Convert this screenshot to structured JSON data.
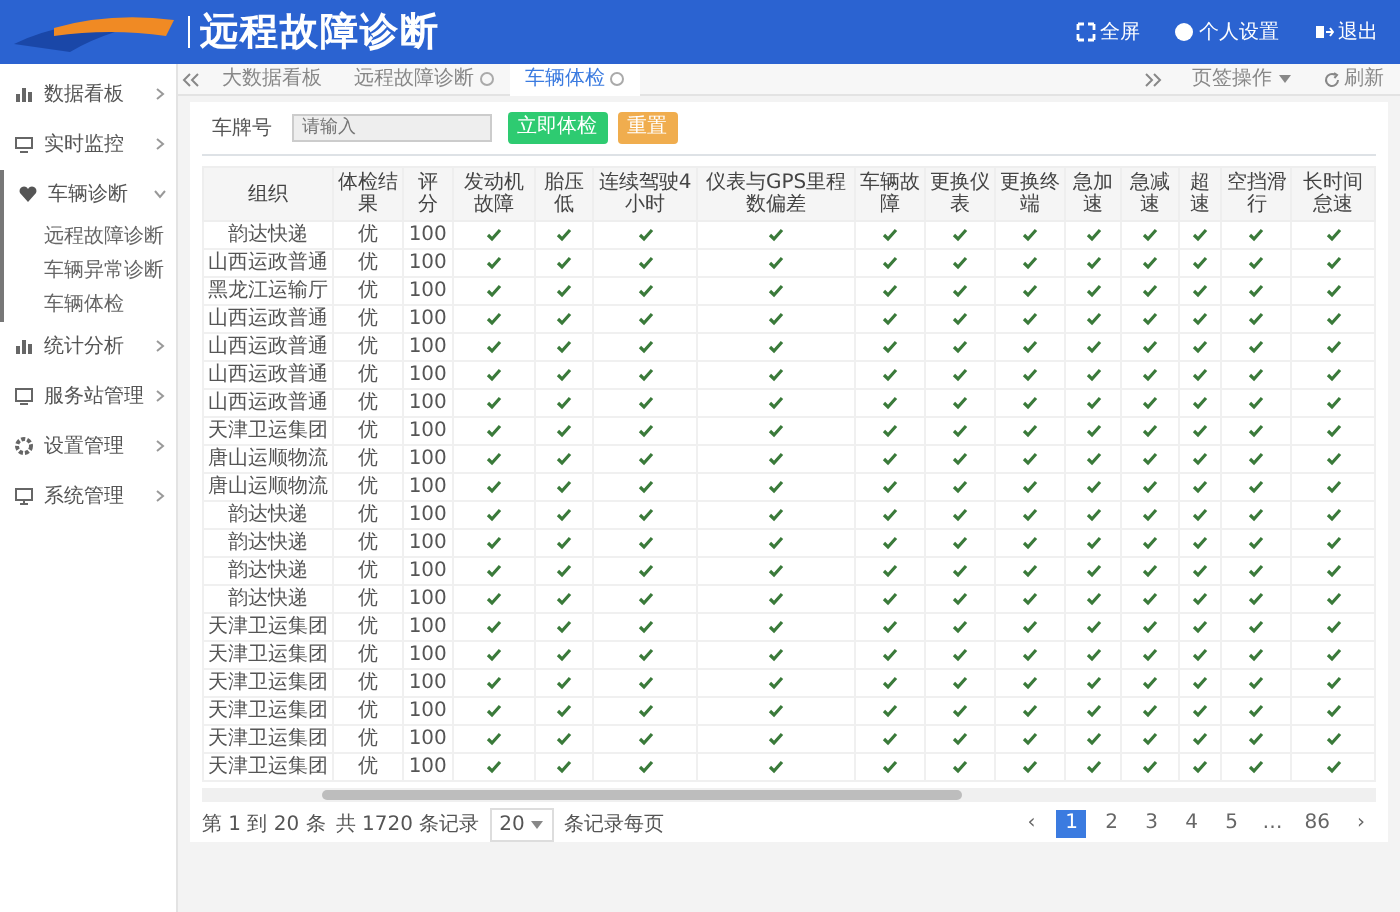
{
  "header": {
    "title": "远程故障诊断",
    "actions": [
      {
        "label": "全屏"
      },
      {
        "label": "个人设置"
      },
      {
        "label": "退出"
      }
    ]
  },
  "sidebar": {
    "items": [
      {
        "label": "数据看板",
        "expanded": false
      },
      {
        "label": "实时监控",
        "expanded": false
      },
      {
        "label": "车辆诊断",
        "expanded": true,
        "children": [
          {
            "label": "远程故障诊断"
          },
          {
            "label": "车辆异常诊断"
          },
          {
            "label": "车辆体检"
          }
        ]
      },
      {
        "label": "统计分析",
        "expanded": false
      },
      {
        "label": "服务站管理",
        "expanded": false
      },
      {
        "label": "设置管理",
        "expanded": false
      },
      {
        "label": "系统管理",
        "expanded": false
      }
    ]
  },
  "tabs": {
    "items": [
      {
        "label": "大数据看板",
        "closable": false,
        "selected": false
      },
      {
        "label": "远程故障诊断",
        "closable": true,
        "selected": false
      },
      {
        "label": "车辆体检",
        "closable": true,
        "selected": true
      }
    ],
    "menu": "页签操作",
    "refresh": "刷新"
  },
  "filter": {
    "label": "车牌号",
    "placeholder": "请输入",
    "buttons": [
      {
        "label": "立即体检",
        "kind": "success"
      },
      {
        "label": "重置",
        "kind": "warning"
      }
    ]
  },
  "table": {
    "columns": [
      "组织",
      "体检结果",
      "评分",
      "发动机故障",
      "胎压低",
      "连续驾驶4小时",
      "仪表与GPS里程数偏差",
      "车辆故障",
      "更换仪表",
      "更换终端",
      "急加速",
      "急减速",
      "超速",
      "空挡滑行",
      "长时间怠速"
    ],
    "rows": [
      {
        "cells": [
          "韵达快递",
          "优",
          "100"
        ],
        "checks": [
          true,
          true,
          true,
          true,
          true,
          true,
          true,
          true,
          true,
          true,
          true,
          true
        ]
      },
      {
        "cells": [
          "山西运政普通",
          "优",
          "100"
        ],
        "checks": [
          true,
          true,
          true,
          true,
          true,
          true,
          true,
          true,
          true,
          true,
          true,
          true
        ]
      },
      {
        "cells": [
          "黑龙江运输厅",
          "优",
          "100"
        ],
        "checks": [
          true,
          true,
          true,
          true,
          true,
          true,
          true,
          true,
          true,
          true,
          true,
          true
        ]
      },
      {
        "cells": [
          "山西运政普通",
          "优",
          "100"
        ],
        "checks": [
          true,
          true,
          true,
          true,
          true,
          true,
          true,
          true,
          true,
          true,
          true,
          true
        ]
      },
      {
        "cells": [
          "山西运政普通",
          "优",
          "100"
        ],
        "checks": [
          true,
          true,
          true,
          true,
          true,
          true,
          true,
          true,
          true,
          true,
          true,
          true
        ]
      },
      {
        "cells": [
          "山西运政普通",
          "优",
          "100"
        ],
        "checks": [
          true,
          true,
          true,
          true,
          true,
          true,
          true,
          true,
          true,
          true,
          true,
          true
        ]
      },
      {
        "cells": [
          "山西运政普通",
          "优",
          "100"
        ],
        "checks": [
          true,
          true,
          true,
          true,
          true,
          true,
          true,
          true,
          true,
          true,
          true,
          true
        ]
      },
      {
        "cells": [
          "天津卫运集团",
          "优",
          "100"
        ],
        "checks": [
          true,
          true,
          true,
          true,
          true,
          true,
          true,
          true,
          true,
          true,
          true,
          true
        ]
      },
      {
        "cells": [
          "唐山运顺物流",
          "优",
          "100"
        ],
        "checks": [
          true,
          true,
          true,
          true,
          true,
          true,
          true,
          true,
          true,
          true,
          true,
          true
        ]
      },
      {
        "cells": [
          "唐山运顺物流",
          "优",
          "100"
        ],
        "checks": [
          true,
          true,
          true,
          true,
          true,
          true,
          true,
          true,
          true,
          true,
          true,
          true
        ]
      },
      {
        "cells": [
          "韵达快递",
          "优",
          "100"
        ],
        "checks": [
          true,
          true,
          true,
          true,
          true,
          true,
          true,
          true,
          true,
          true,
          true,
          true
        ]
      },
      {
        "cells": [
          "韵达快递",
          "优",
          "100"
        ],
        "checks": [
          true,
          true,
          true,
          true,
          true,
          true,
          true,
          true,
          true,
          true,
          true,
          true
        ]
      },
      {
        "cells": [
          "韵达快递",
          "优",
          "100"
        ],
        "checks": [
          true,
          true,
          true,
          true,
          true,
          true,
          true,
          true,
          true,
          true,
          true,
          true
        ]
      },
      {
        "cells": [
          "韵达快递",
          "优",
          "100"
        ],
        "checks": [
          true,
          true,
          true,
          true,
          true,
          true,
          true,
          true,
          true,
          true,
          true,
          true
        ]
      },
      {
        "cells": [
          "天津卫运集团",
          "优",
          "100"
        ],
        "checks": [
          true,
          true,
          true,
          true,
          true,
          true,
          true,
          true,
          true,
          true,
          true,
          true
        ]
      },
      {
        "cells": [
          "天津卫运集团",
          "优",
          "100"
        ],
        "checks": [
          true,
          true,
          true,
          true,
          true,
          true,
          true,
          true,
          true,
          true,
          true,
          true
        ]
      },
      {
        "cells": [
          "天津卫运集团",
          "优",
          "100"
        ],
        "checks": [
          true,
          true,
          true,
          true,
          true,
          true,
          true,
          true,
          true,
          true,
          true,
          true
        ]
      },
      {
        "cells": [
          "天津卫运集团",
          "优",
          "100"
        ],
        "checks": [
          true,
          true,
          true,
          true,
          true,
          true,
          true,
          true,
          true,
          true,
          true,
          true
        ]
      },
      {
        "cells": [
          "天津卫运集团",
          "优",
          "100"
        ],
        "checks": [
          true,
          true,
          true,
          true,
          true,
          true,
          true,
          true,
          true,
          true,
          true,
          true
        ]
      },
      {
        "cells": [
          "天津卫运集团",
          "优",
          "100"
        ],
        "checks": [
          true,
          true,
          true,
          true,
          true,
          true,
          true,
          true,
          true,
          true,
          true,
          true
        ]
      }
    ]
  },
  "pagination": {
    "summary": "第 1 到 20 条",
    "total": "共 1720 条记录",
    "page_size": "20",
    "page_size_suffix": "条记录每页",
    "pages": [
      {
        "label": "‹",
        "selected": false
      },
      {
        "label": "1",
        "selected": true
      },
      {
        "label": "2",
        "selected": false
      },
      {
        "label": "3",
        "selected": false
      },
      {
        "label": "4",
        "selected": false
      },
      {
        "label": "5",
        "selected": false
      },
      {
        "label": "…",
        "selected": false
      },
      {
        "label": "86",
        "selected": false
      },
      {
        "label": "›",
        "selected": false
      }
    ]
  }
}
